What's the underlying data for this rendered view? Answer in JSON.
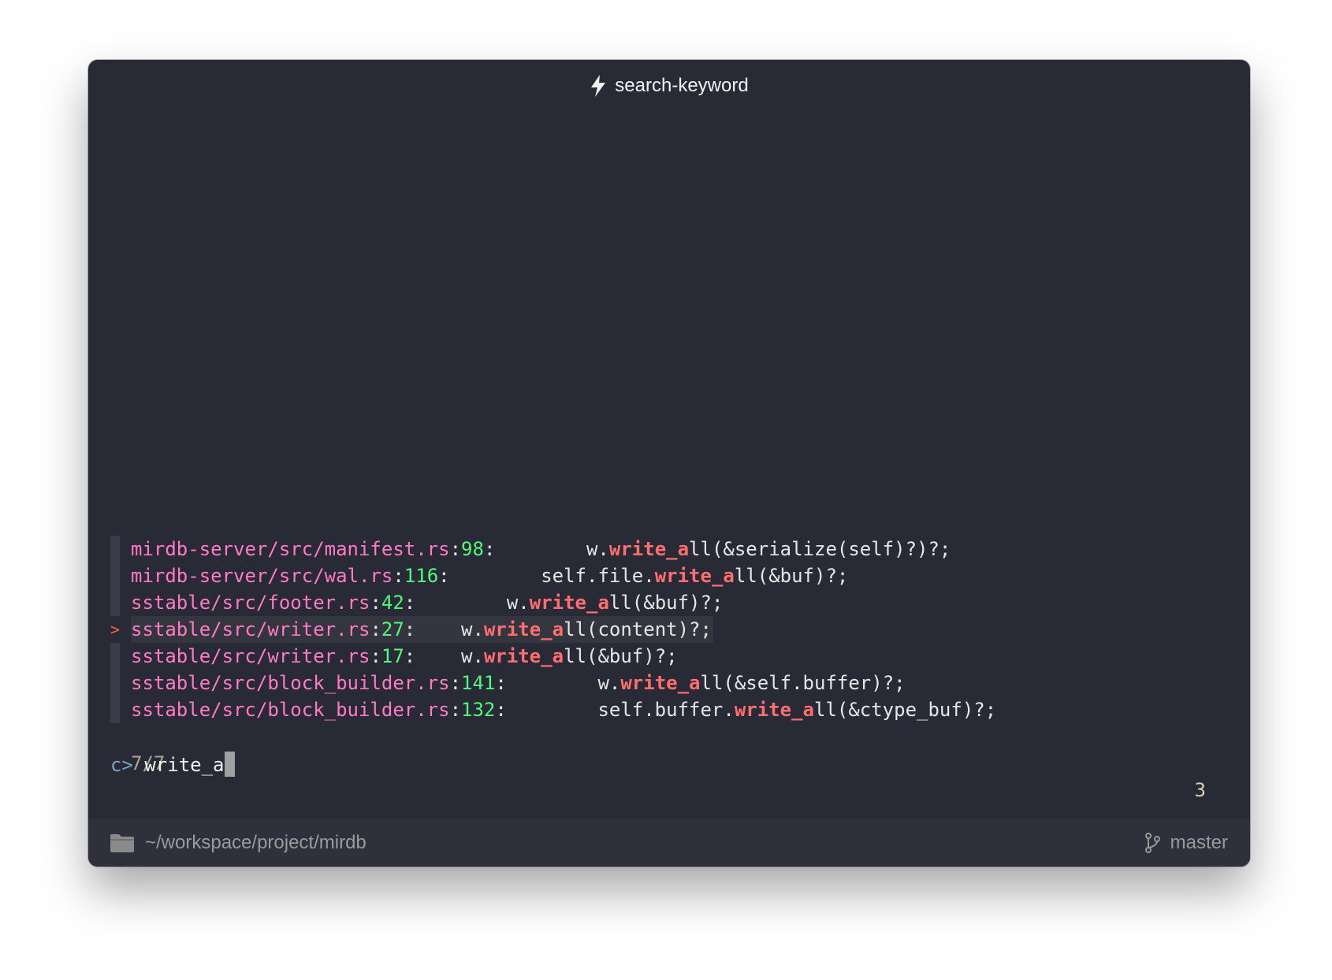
{
  "window": {
    "title": "search-keyword"
  },
  "results": [
    {
      "path": "mirdb-server/src/manifest.rs",
      "line": "98",
      "pad": "        ",
      "pre": "w.",
      "match": "write_a",
      "post": "ll(&serialize(self)?)?;",
      "selected": false
    },
    {
      "path": "mirdb-server/src/wal.rs",
      "line": "116",
      "pad": "        ",
      "pre": "self.file.",
      "match": "write_a",
      "post": "ll(&buf)?;",
      "selected": false
    },
    {
      "path": "sstable/src/footer.rs",
      "line": "42",
      "pad": "        ",
      "pre": "w.",
      "match": "write_a",
      "post": "ll(&buf)?;",
      "selected": false
    },
    {
      "path": "sstable/src/writer.rs",
      "line": "27",
      "pad": "    ",
      "pre": "w.",
      "match": "write_a",
      "post": "ll(content)?;",
      "selected": true
    },
    {
      "path": "sstable/src/writer.rs",
      "line": "17",
      "pad": "    ",
      "pre": "w.",
      "match": "write_a",
      "post": "ll(&buf)?;",
      "selected": false
    },
    {
      "path": "sstable/src/block_builder.rs",
      "line": "141",
      "pad": "        ",
      "pre": "w.",
      "match": "write_a",
      "post": "ll(&self.buffer)?;",
      "selected": false
    },
    {
      "path": "sstable/src/block_builder.rs",
      "line": "132",
      "pad": "        ",
      "pre": "self.buffer.",
      "match": "write_a",
      "post": "ll(&ctype_buf)?;",
      "selected": false
    }
  ],
  "selection_marker": ">",
  "match_count": "7/7",
  "right_indicator": "3",
  "prompt": {
    "sigil": "c>",
    "query": "write_a"
  },
  "statusbar": {
    "path": "~/workspace/project/mirdb",
    "branch": "master"
  },
  "colors": {
    "background": "#282a36",
    "path": "#ff79c6",
    "line_number": "#50fa7b",
    "match": "#ff6e6e",
    "marker": "#ff5555"
  }
}
